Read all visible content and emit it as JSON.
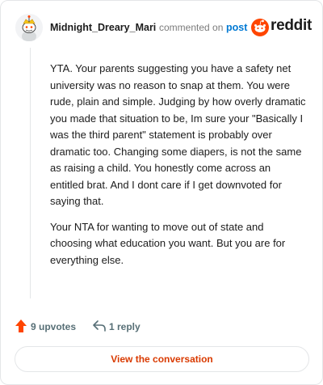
{
  "header": {
    "author": "Midnight_Dreary_Mari",
    "action_text": "commented on",
    "post_link": "post",
    "brand": "reddit"
  },
  "comment": {
    "paragraphs": [
      "YTA. Your parents suggesting you have a safety net university was no reason to snap at them. You were rude, plain and simple. Judging by how overly dramatic you made that situation to be, Im sure your \"Basically I was the third parent\" statement is probably over dramatic too. Changing some diapers, is not the same as raising a child. You honestly come across an entitled brat. And I dont care if I get downvoted for saying that.",
      "Your NTA for wanting to move out of state and choosing what education you want. But you are for everything else."
    ]
  },
  "actions": {
    "upvotes_label": "9 upvotes",
    "replies_label": "1 reply"
  },
  "footer": {
    "view_button": "View the conversation"
  },
  "colors": {
    "upvote": "#ff4500",
    "brand": "#ff4500",
    "link": "#0079d3",
    "cta": "#d93a00"
  },
  "icons": {
    "avatar": "snoo-avatar",
    "brand": "reddit-logo-icon",
    "upvote": "upvote-arrow-icon",
    "reply": "reply-arrow-icon"
  }
}
